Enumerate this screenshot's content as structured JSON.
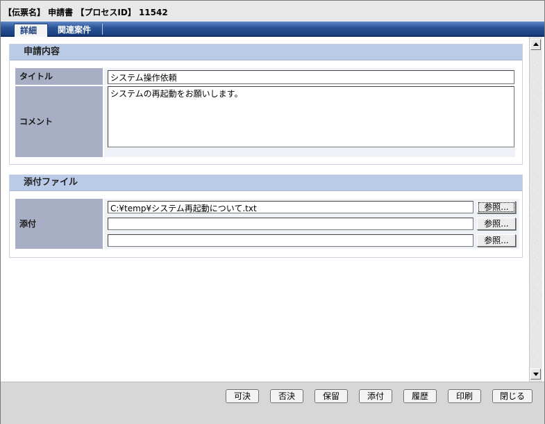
{
  "header": {
    "title": "【伝票名】 申請書 【プロセスID】 11542"
  },
  "tabs": [
    {
      "label": "詳細"
    },
    {
      "label": "関連案件"
    }
  ],
  "application": {
    "section_title": "申請内容",
    "title_label": "タイトル",
    "title_value": "システム操作依頼",
    "comment_label": "コメント",
    "comment_value": "システムの再起動をお願いします。"
  },
  "attachments": {
    "section_title": "添付ファイル",
    "label": "添付",
    "files": [
      {
        "value": "C:¥temp¥システム再起動について.txt",
        "browse_label": "参照..."
      },
      {
        "value": "",
        "browse_label": "参照..."
      },
      {
        "value": "",
        "browse_label": "参照..."
      }
    ]
  },
  "actions": {
    "approve": "可決",
    "reject": "否決",
    "hold": "保留",
    "attach": "添付",
    "history": "履歴",
    "print": "印刷",
    "close": "閉じる"
  }
}
